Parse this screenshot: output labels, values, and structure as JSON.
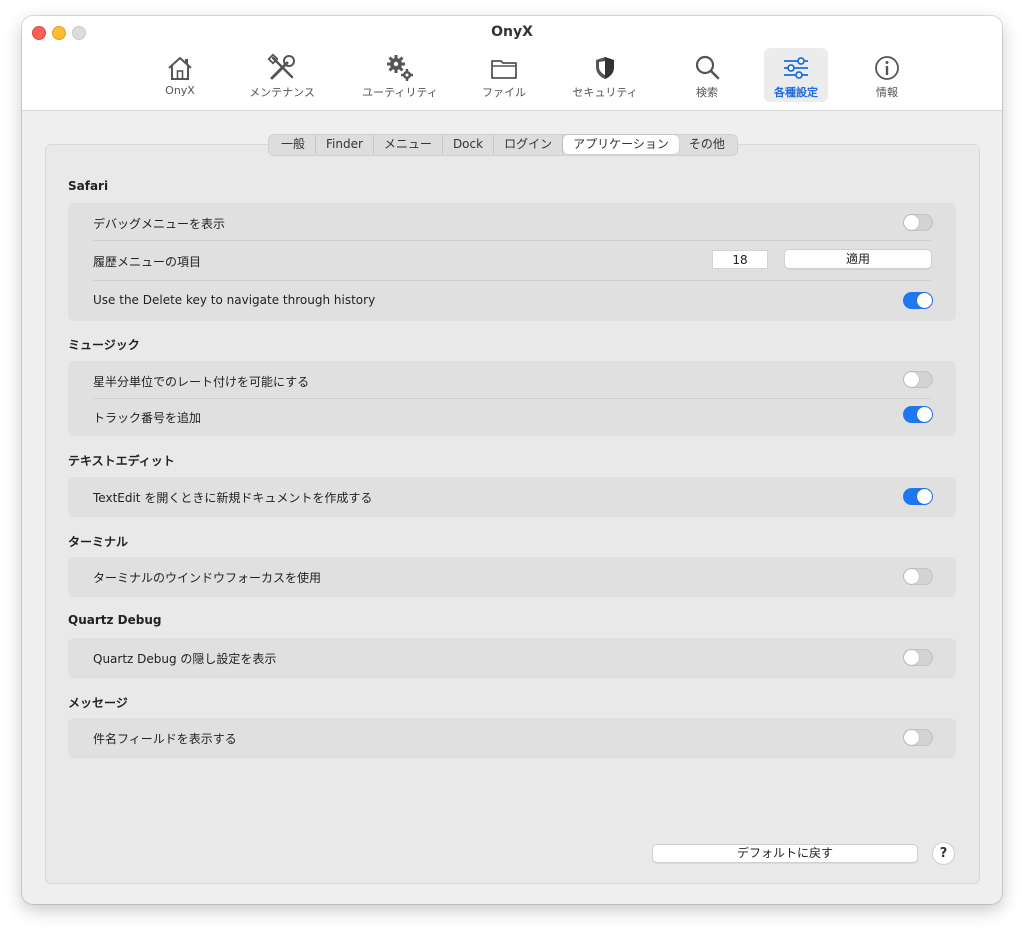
{
  "window": {
    "title": "OnyX"
  },
  "toolbar": {
    "items": [
      {
        "label": "OnyX",
        "icon": "home-icon"
      },
      {
        "label": "メンテナンス",
        "icon": "tools-icon"
      },
      {
        "label": "ユーティリティ",
        "icon": "gears-icon"
      },
      {
        "label": "ファイル",
        "icon": "folder-icon"
      },
      {
        "label": "セキュリティ",
        "icon": "shield-icon"
      },
      {
        "label": "検索",
        "icon": "magnifier-icon"
      },
      {
        "label": "各種設定",
        "icon": "sliders-icon"
      },
      {
        "label": "情報",
        "icon": "info-icon"
      }
    ],
    "active": "各種設定",
    "accent_color": "#1f6fe0"
  },
  "tabs": {
    "items": [
      "一般",
      "Finder",
      "メニュー",
      "Dock",
      "ログイン",
      "アプリケーション",
      "その他"
    ],
    "selected": "アプリケーション"
  },
  "sections": {
    "safari": {
      "title": "Safari",
      "debug_menu": {
        "label": "デバッグメニューを表示",
        "enabled": false
      },
      "history_items": {
        "label": "履歴メニューの項目",
        "value": "18",
        "apply_label": "適用"
      },
      "delete_key": {
        "label": "Use the Delete key to navigate through history",
        "enabled": true
      }
    },
    "music": {
      "title": "ミュージック",
      "half_star": {
        "label": "星半分単位でのレート付けを可能にする",
        "enabled": false
      },
      "track_number": {
        "label": "トラック番号を追加",
        "enabled": true
      }
    },
    "textedit": {
      "title": "テキストエディット",
      "new_document": {
        "label": "TextEdit を開くときに新規ドキュメントを作成する",
        "enabled": true
      }
    },
    "terminal": {
      "title": "ターミナル",
      "focus_follows": {
        "label": "ターミナルのウインドウフォーカスを使用",
        "enabled": false
      }
    },
    "quartz": {
      "title": "Quartz Debug",
      "hidden_settings": {
        "label": "Quartz Debug の隠し設定を表示",
        "enabled": false
      }
    },
    "messages": {
      "title": "メッセージ",
      "subject_field": {
        "label": "件名フィールドを表示する",
        "enabled": false
      }
    }
  },
  "footer": {
    "restore_defaults_label": "デフォルトに戻す",
    "help_label": "?"
  },
  "colors": {
    "toggle_on": "#1f77f0",
    "toggle_off": "#d3d3d3"
  }
}
